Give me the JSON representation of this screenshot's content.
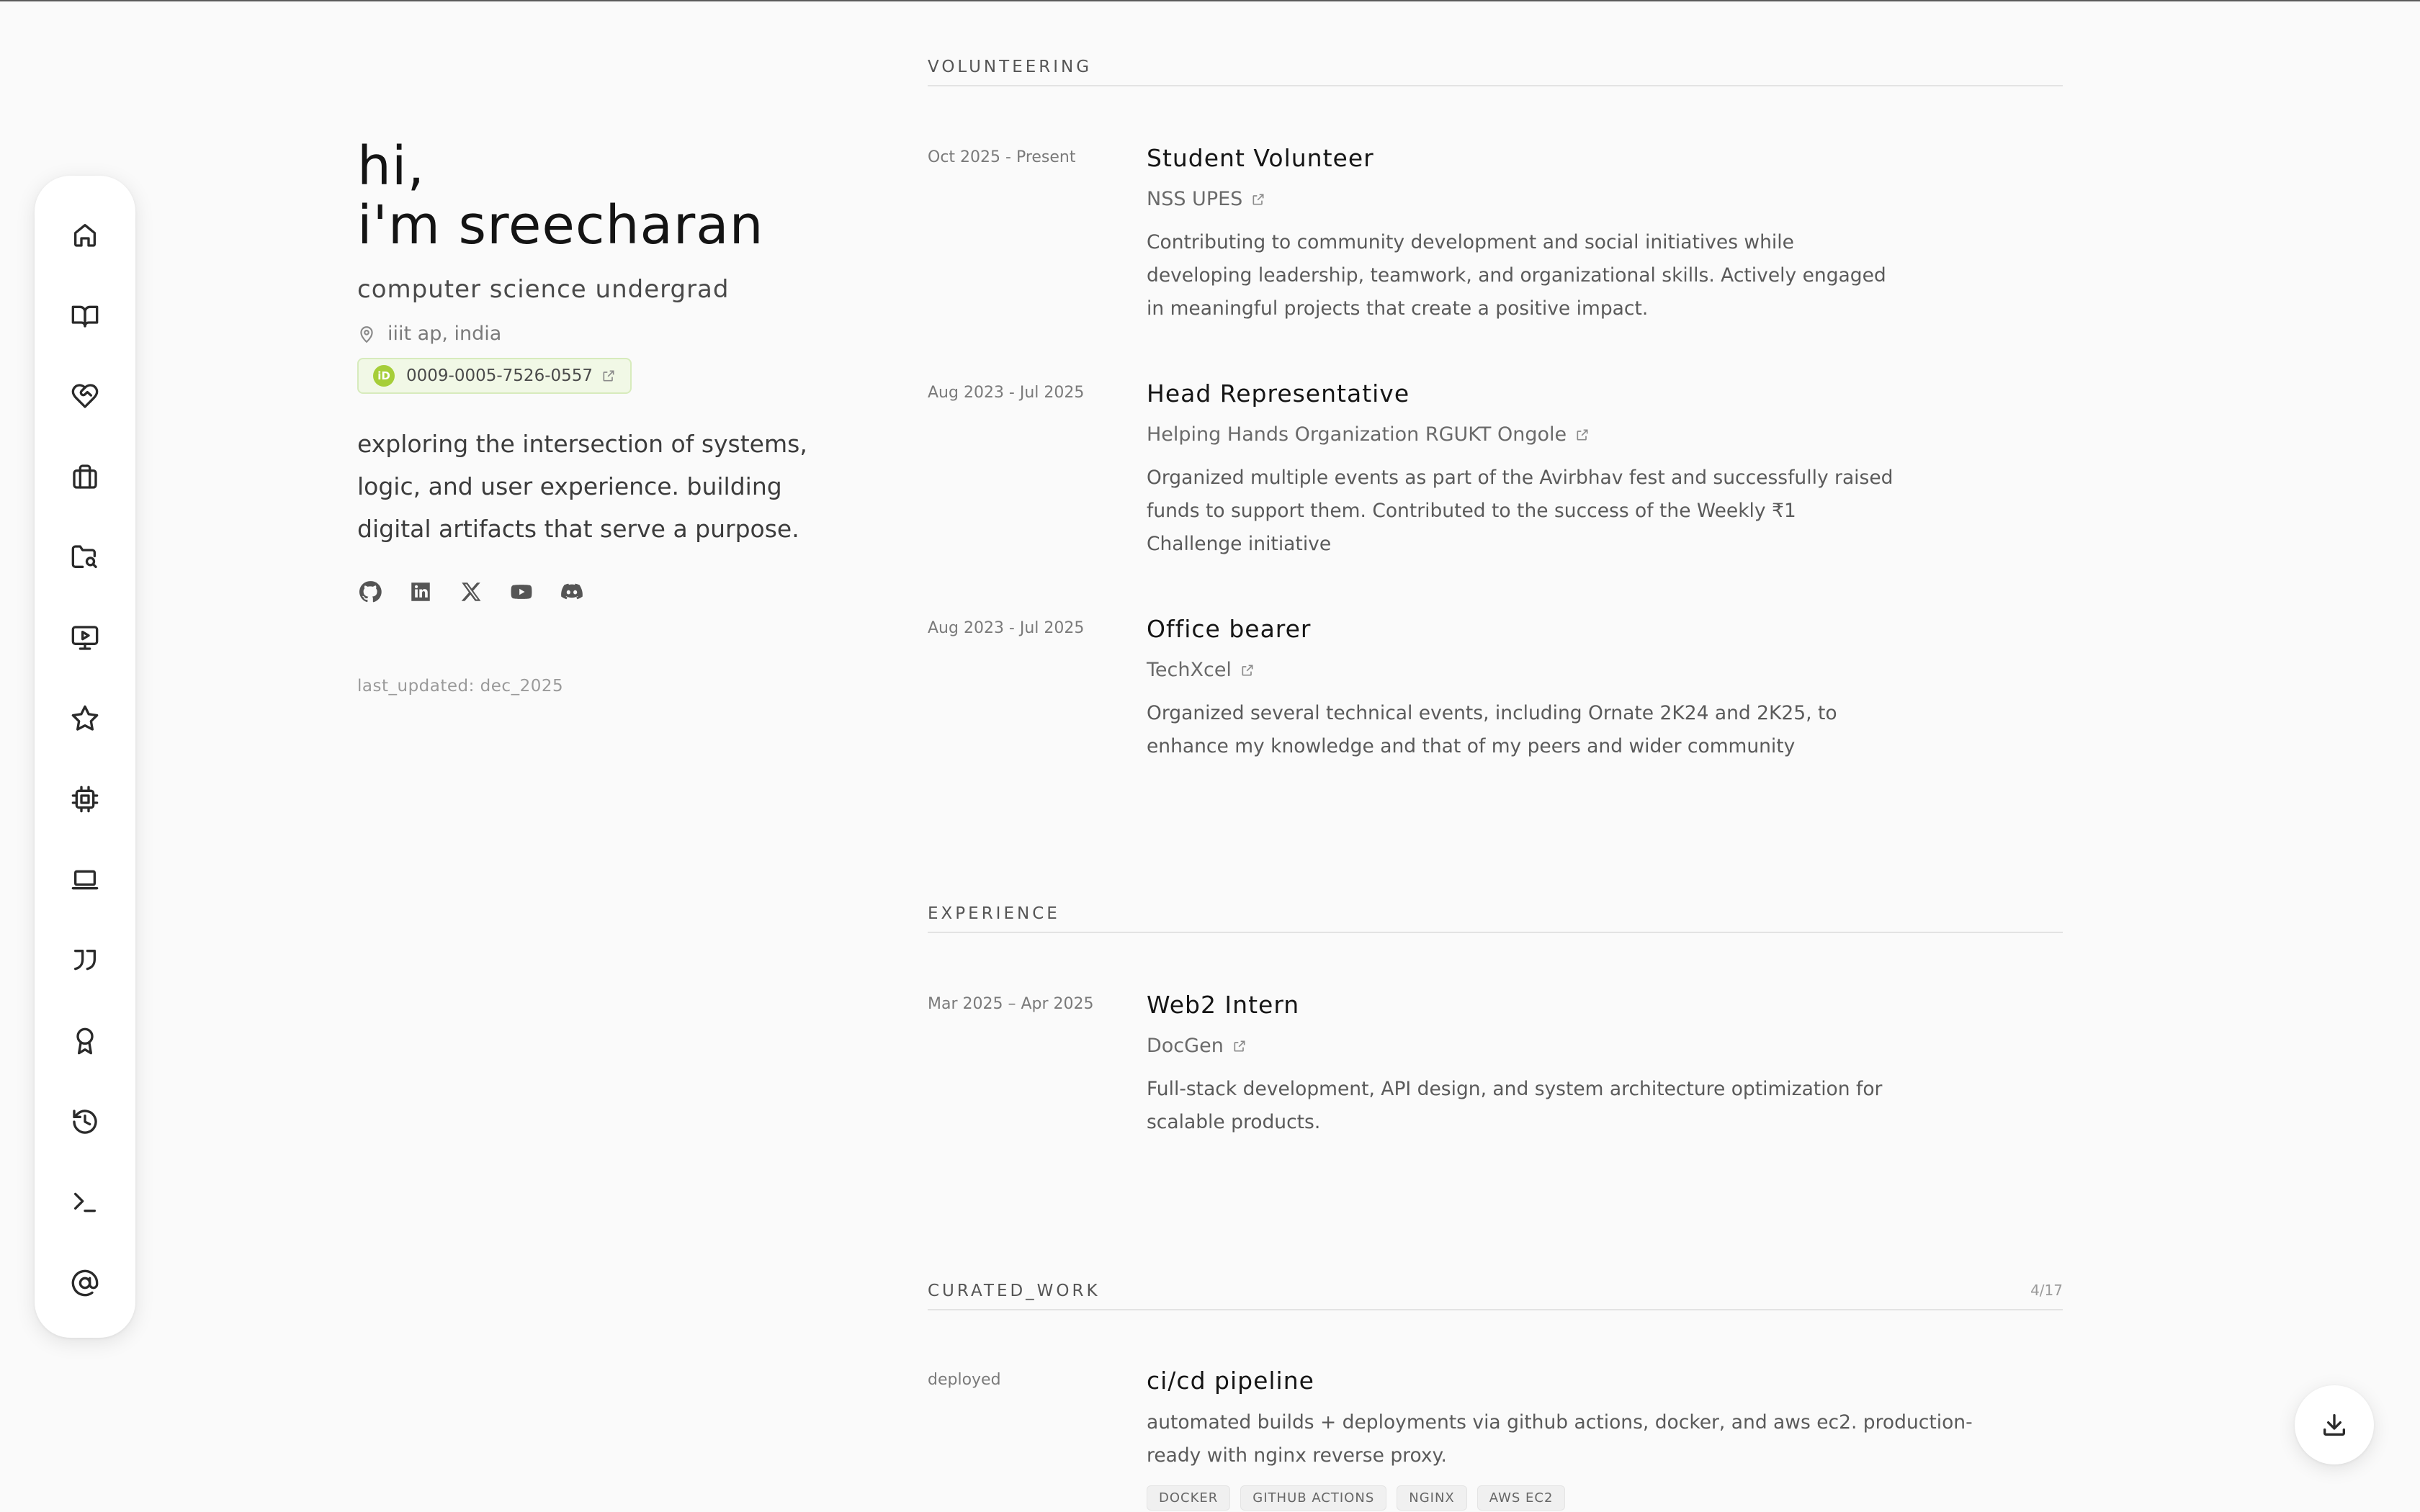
{
  "profile": {
    "greeting_line1": "hi,",
    "greeting_line2": "i'm sreecharan",
    "role": "computer science undergrad",
    "location": "iiit ap, india",
    "orcid_badge": "iD",
    "orcid": "0009-0005-7526-0557",
    "tagline": "exploring the intersection of systems, logic, and user experience. building digital artifacts that serve a purpose.",
    "last_updated": "last_updated: dec_2025",
    "socials": [
      "github-icon",
      "linkedin-icon",
      "x-icon",
      "youtube-icon",
      "discord-icon"
    ]
  },
  "sidebar": {
    "icons": [
      "home-icon",
      "book-open-icon",
      "heart-handshake-icon",
      "briefcase-icon",
      "folder-search-icon",
      "presentation-icon",
      "star-icon",
      "cpu-icon",
      "laptop-icon",
      "quote-icon",
      "award-icon",
      "history-icon",
      "terminal-icon",
      "at-sign-icon"
    ]
  },
  "volunteering": {
    "heading": "VOLUNTEERING",
    "items": [
      {
        "date": "Oct 2025 - Present",
        "title": "Student Volunteer",
        "org": "NSS UPES",
        "desc": "Contributing to community development and social initiatives while developing leadership, teamwork, and organizational skills. Actively engaged in meaningful projects that create a positive impact."
      },
      {
        "date": "Aug 2023 - Jul 2025",
        "title": "Head Representative",
        "org": "Helping Hands Organization RGUKT Ongole",
        "desc": "Organized multiple events as part of the Avirbhav fest and successfully raised funds to support them. Contributed to the success of the Weekly ₹1 Challenge initiative"
      },
      {
        "date": "Aug 2023 - Jul 2025",
        "title": "Office bearer",
        "org": "TechXcel",
        "desc": "Organized several technical events, including Ornate 2K24 and 2K25, to enhance my knowledge and that of my peers and wider community"
      }
    ]
  },
  "experience": {
    "heading": "EXPERIENCE",
    "items": [
      {
        "date": "Mar 2025 – Apr 2025",
        "title": "Web2 Intern",
        "org": "DocGen",
        "desc": "Full-stack development, API design, and system architecture optimization for scalable products."
      }
    ]
  },
  "curated_work": {
    "heading": "CURATED_WORK",
    "count": "4/17",
    "items": [
      {
        "status": "deployed",
        "title": "ci/cd pipeline",
        "desc": "automated builds + deployments via github actions, docker, and aws ec2. production-ready with nginx reverse proxy.",
        "tags": [
          "DOCKER",
          "GITHUB ACTIONS",
          "NGINX",
          "AWS EC2"
        ]
      }
    ]
  },
  "colors": {
    "background": "#fafafa",
    "orcid_green": "#a6ce39",
    "text": "#1a1a1a"
  }
}
